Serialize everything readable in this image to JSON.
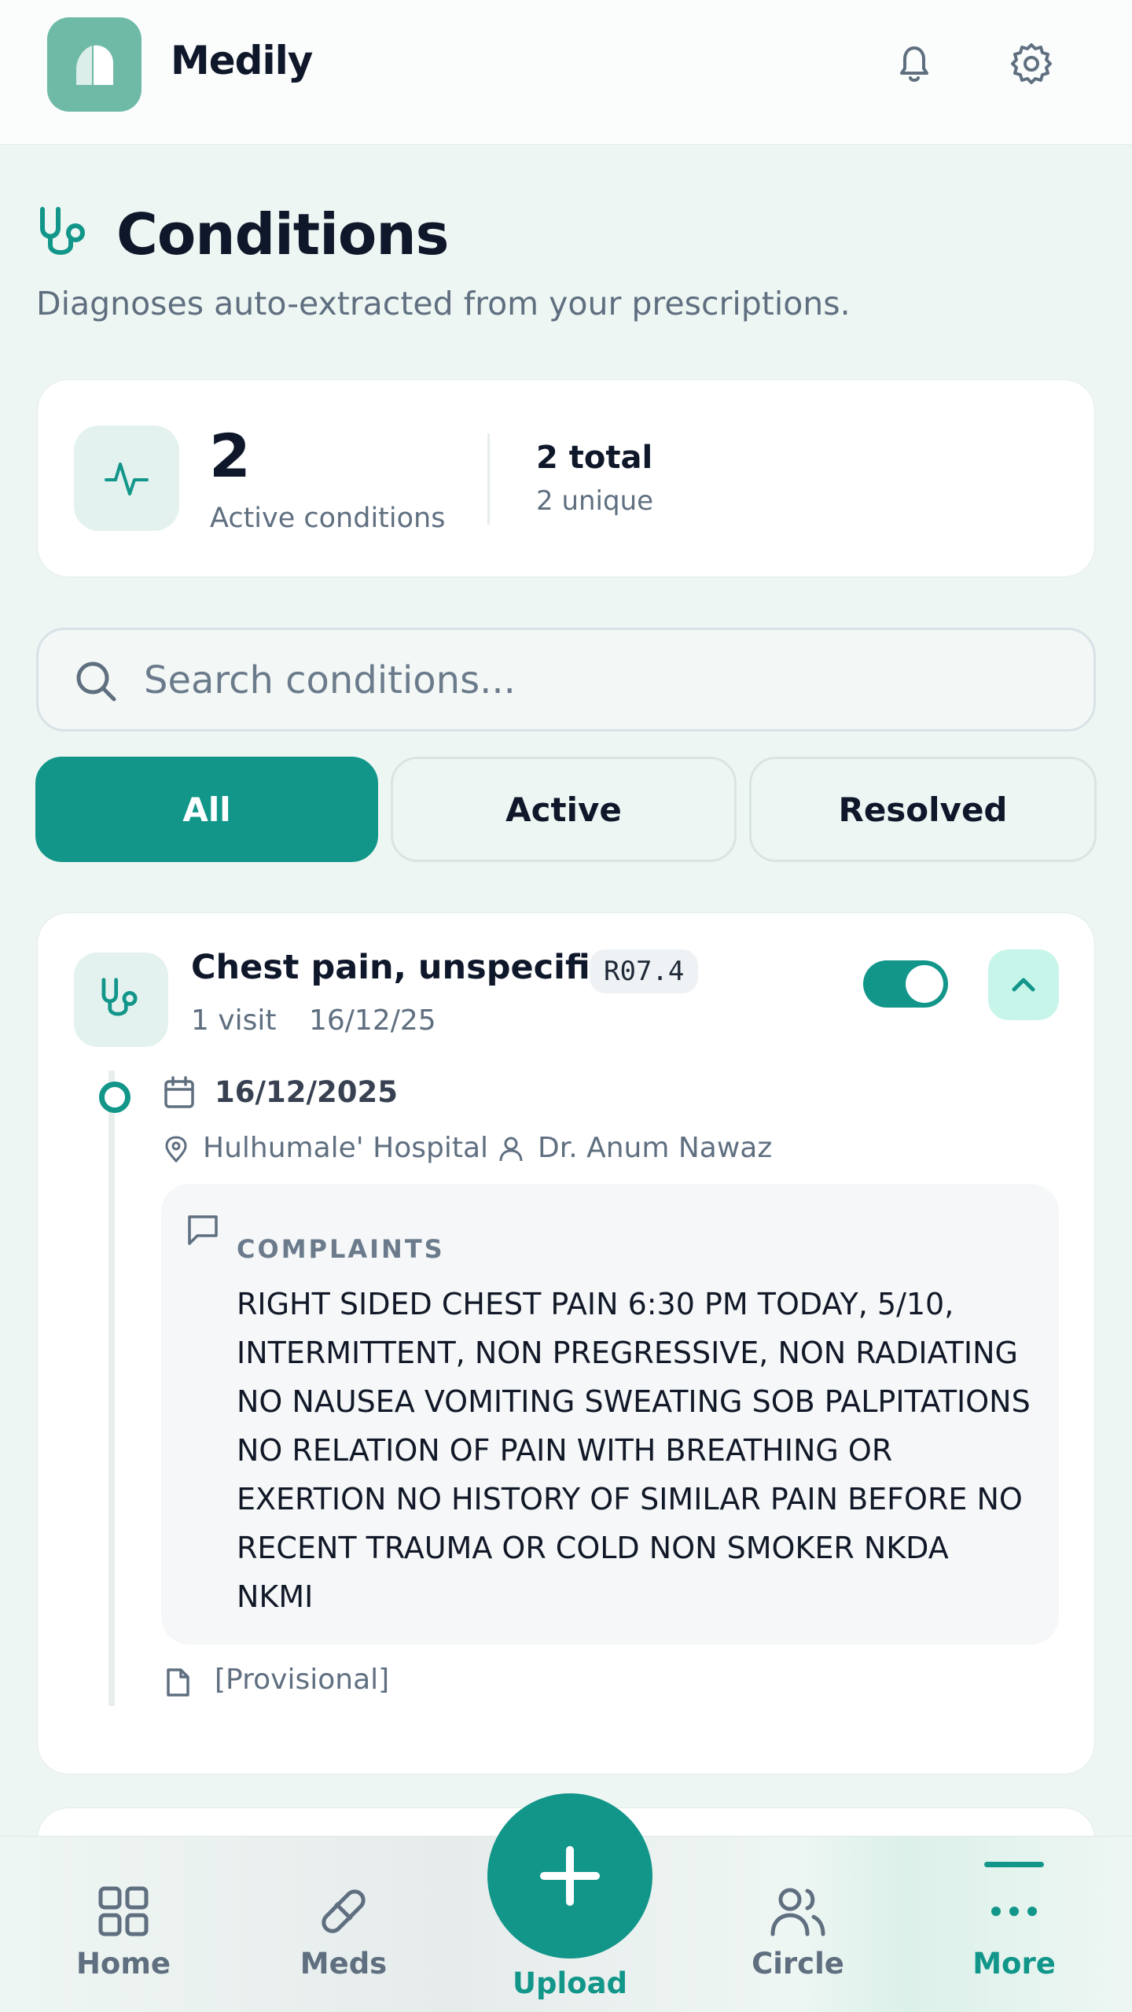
{
  "app": {
    "name": "Medily"
  },
  "header": {
    "notifications_icon": "bell-icon",
    "settings_icon": "gear-icon"
  },
  "page": {
    "title": "Conditions",
    "subtitle": "Diagnoses auto-extracted from your prescriptions."
  },
  "stats": {
    "active_count": "2",
    "active_label": "Active conditions",
    "total": "2 total",
    "unique": "2 unique"
  },
  "search": {
    "placeholder": "Search conditions..."
  },
  "filters": {
    "all": "All",
    "active": "Active",
    "resolved": "Resolved",
    "selected": "All"
  },
  "conditions": [
    {
      "name": "Chest pain, unspecified",
      "code": "R07.4",
      "visits": "1 visit",
      "last_date": "16/12/25",
      "active": true,
      "expanded": true,
      "visit_list": [
        {
          "date": "16/12/2025",
          "location": "Hulhumale' Hospital",
          "doctor": "Dr. Anum Nawaz",
          "complaints_label": "COMPLAINTS",
          "complaints": "RIGHT SIDED CHEST PAIN 6:30 PM TODAY, 5/10, INTERMITTENT, NON PREGRESSIVE, NON RADIATING NO NAUSEA VOMITING SWEATING SOB PALPITATIONS NO RELATION OF PAIN WITH BREATHING OR EXERTION NO HISTORY OF SIMILAR PAIN BEFORE NO RECENT TRAUMA OR COLD NON SMOKER NKDA NKMI",
          "note": "[Provisional]"
        }
      ]
    }
  ],
  "bottom_nav": {
    "home": "Home",
    "meds": "Meds",
    "upload": "Upload",
    "circle": "Circle",
    "more": "More",
    "active": "More"
  },
  "colors": {
    "accent": "#12968a",
    "logo": "#6fbaa6",
    "background": "#eef6f3"
  }
}
